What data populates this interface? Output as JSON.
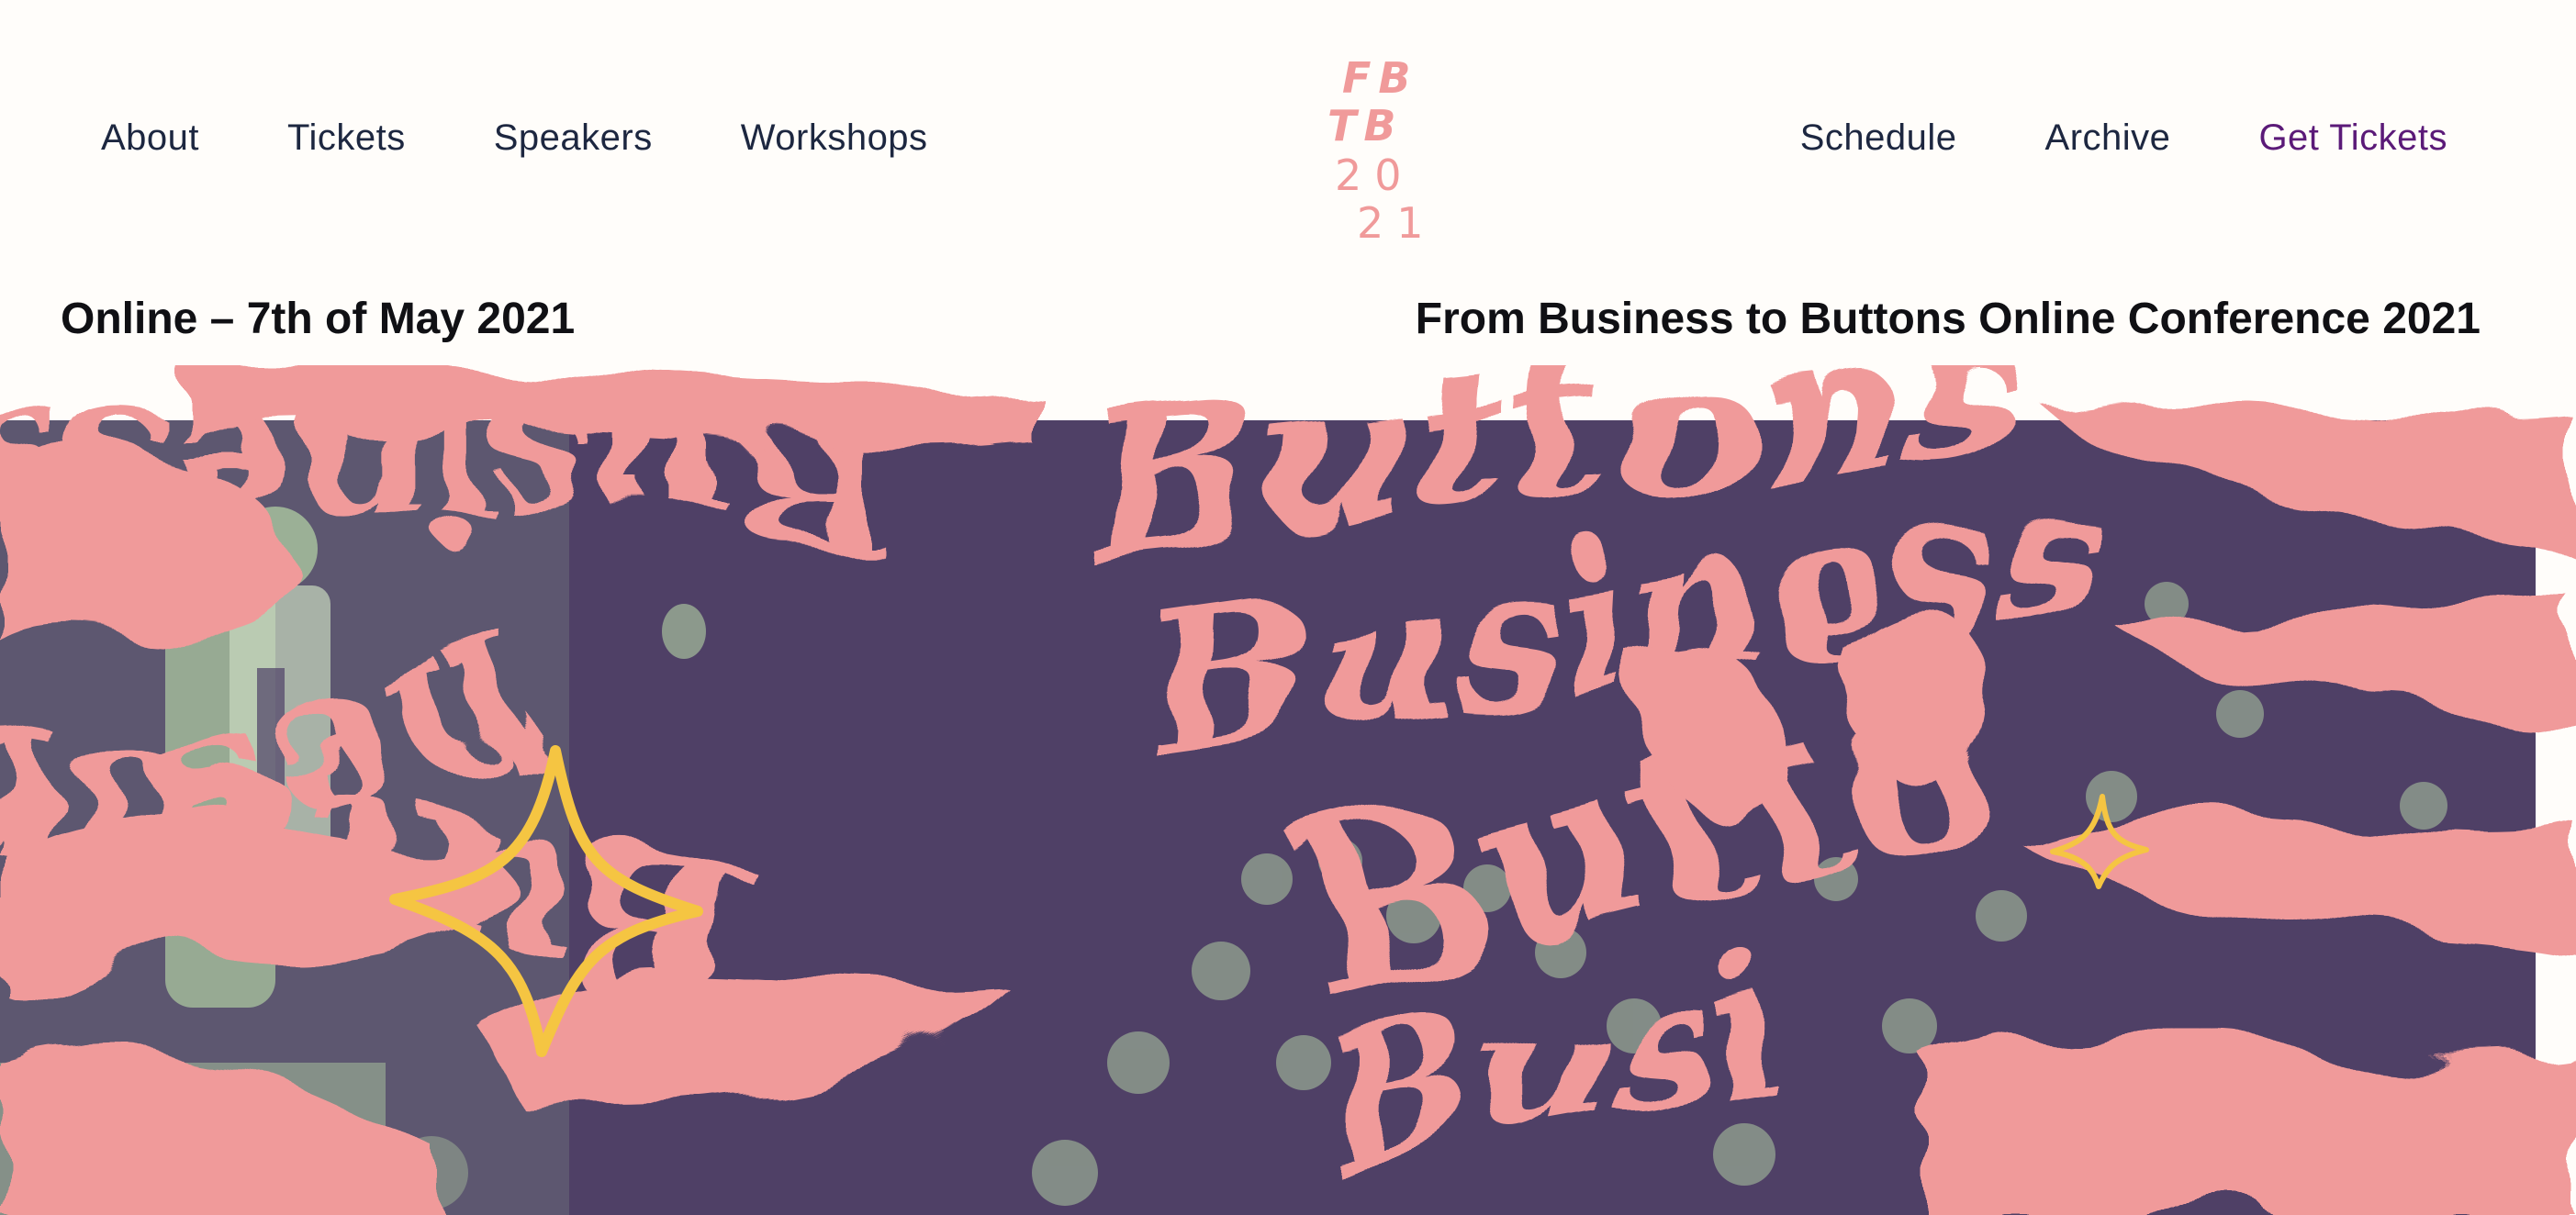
{
  "nav": {
    "left": [
      {
        "label": "About"
      },
      {
        "label": "Tickets"
      },
      {
        "label": "Speakers"
      },
      {
        "label": "Workshops"
      }
    ],
    "right": [
      {
        "label": "Schedule"
      },
      {
        "label": "Archive"
      },
      {
        "label": "Get Tickets"
      }
    ]
  },
  "logo": {
    "line1": "FB",
    "line2": "TB",
    "line3": "20",
    "line4": "21"
  },
  "info": {
    "date": "Online – 7th of May 2021",
    "event": "From Business to Buttons Online Conference 2021"
  },
  "hero": {
    "words": [
      "Buttons",
      "Business",
      "Butto",
      "Busi",
      "nes",
      "Button",
      "Business"
    ]
  },
  "colors": {
    "background": "#fffdfa",
    "nav_text": "#1d2740",
    "cta": "#5b1a78",
    "accent_pink": "#f09a9a",
    "hero_purple": "#4f4066",
    "photo_tint": "#a6bf9c",
    "star_yellow": "#f5c542"
  }
}
